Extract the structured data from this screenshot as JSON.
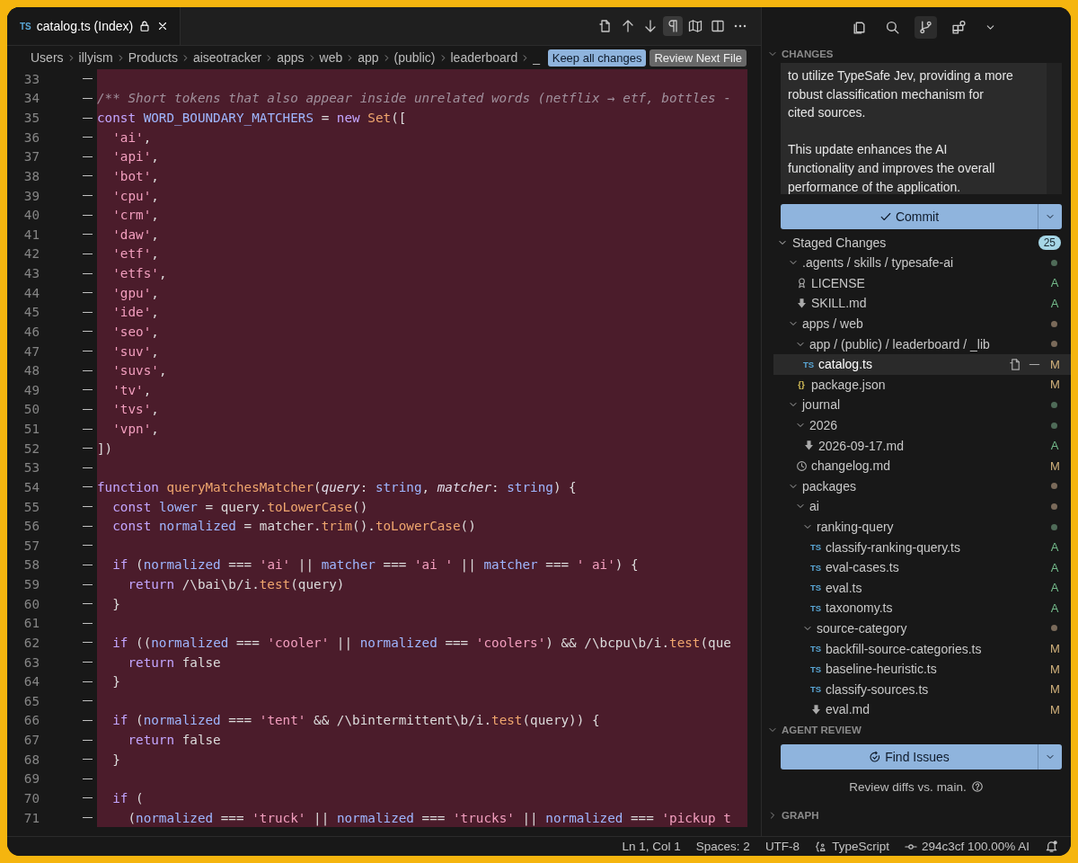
{
  "editor": {
    "tab": {
      "icon_text": "TS",
      "title": "catalog.ts (Index)",
      "locked": true
    },
    "actions": [
      {
        "selected": false
      },
      {
        "selected": false
      },
      {
        "selected": false
      },
      {
        "selected": true
      },
      {
        "selected": false
      },
      {
        "selected": false
      },
      {
        "selected": false
      }
    ],
    "breadcrumbs": [
      "Users",
      "illyism",
      "Products",
      "aiseotracker",
      "apps",
      "web",
      "app",
      "(public)",
      "leaderboard",
      "_"
    ],
    "buttons": [
      {
        "label": "Keep all changes",
        "kind": "primary"
      },
      {
        "label": "Review Next File",
        "kind": "secondary"
      }
    ],
    "lines": [
      {
        "number": "33",
        "deleted": true
      },
      {
        "number": "34",
        "deleted": true,
        "tokens": [
          {
            "kind": "comment",
            "text": "/** Short tokens that also appear inside unrelated words (netflix → etf, bottles -"
          }
        ]
      },
      {
        "number": "35",
        "deleted": true,
        "tokens": [
          {
            "kind": "kw",
            "text": "const "
          },
          {
            "kind": "var",
            "text": "WORD_BOUNDARY_MATCHERS"
          },
          {
            "kind": "plain",
            "text": " = "
          },
          {
            "kind": "kw",
            "text": "new "
          },
          {
            "kind": "fn",
            "text": "Set"
          },
          {
            "kind": "plain",
            "text": "(["
          }
        ]
      },
      {
        "number": "36",
        "deleted": true,
        "tokens": [
          {
            "kind": "str",
            "text": "  'ai'"
          },
          {
            "kind": "plain",
            "text": ","
          }
        ]
      },
      {
        "number": "37",
        "deleted": true,
        "tokens": [
          {
            "kind": "str",
            "text": "  'api'"
          },
          {
            "kind": "plain",
            "text": ","
          }
        ]
      },
      {
        "number": "38",
        "deleted": true,
        "tokens": [
          {
            "kind": "str",
            "text": "  'bot'"
          },
          {
            "kind": "plain",
            "text": ","
          }
        ]
      },
      {
        "number": "39",
        "deleted": true,
        "tokens": [
          {
            "kind": "str",
            "text": "  'cpu'"
          },
          {
            "kind": "plain",
            "text": ","
          }
        ]
      },
      {
        "number": "40",
        "deleted": true,
        "tokens": [
          {
            "kind": "str",
            "text": "  'crm'"
          },
          {
            "kind": "plain",
            "text": ","
          }
        ]
      },
      {
        "number": "41",
        "deleted": true,
        "tokens": [
          {
            "kind": "str",
            "text": "  'daw'"
          },
          {
            "kind": "plain",
            "text": ","
          }
        ]
      },
      {
        "number": "42",
        "deleted": true,
        "tokens": [
          {
            "kind": "str",
            "text": "  'etf'"
          },
          {
            "kind": "plain",
            "text": ","
          }
        ]
      },
      {
        "number": "43",
        "deleted": true,
        "tokens": [
          {
            "kind": "str",
            "text": "  'etfs'"
          },
          {
            "kind": "plain",
            "text": ","
          }
        ]
      },
      {
        "number": "44",
        "deleted": true,
        "tokens": [
          {
            "kind": "str",
            "text": "  'gpu'"
          },
          {
            "kind": "plain",
            "text": ","
          }
        ]
      },
      {
        "number": "45",
        "deleted": true,
        "tokens": [
          {
            "kind": "str",
            "text": "  'ide'"
          },
          {
            "kind": "plain",
            "text": ","
          }
        ]
      },
      {
        "number": "46",
        "deleted": true,
        "tokens": [
          {
            "kind": "str",
            "text": "  'seo'"
          },
          {
            "kind": "plain",
            "text": ","
          }
        ]
      },
      {
        "number": "47",
        "deleted": true,
        "tokens": [
          {
            "kind": "str",
            "text": "  'suv'"
          },
          {
            "kind": "plain",
            "text": ","
          }
        ]
      },
      {
        "number": "48",
        "deleted": true,
        "tokens": [
          {
            "kind": "str",
            "text": "  'suvs'"
          },
          {
            "kind": "plain",
            "text": ","
          }
        ]
      },
      {
        "number": "49",
        "deleted": true,
        "tokens": [
          {
            "kind": "str",
            "text": "  'tv'"
          },
          {
            "kind": "plain",
            "text": ","
          }
        ]
      },
      {
        "number": "50",
        "deleted": true,
        "tokens": [
          {
            "kind": "str",
            "text": "  'tvs'"
          },
          {
            "kind": "plain",
            "text": ","
          }
        ]
      },
      {
        "number": "51",
        "deleted": true,
        "tokens": [
          {
            "kind": "str",
            "text": "  'vpn'"
          },
          {
            "kind": "plain",
            "text": ","
          }
        ]
      },
      {
        "number": "52",
        "deleted": true,
        "tokens": [
          {
            "kind": "plain",
            "text": "])"
          }
        ]
      },
      {
        "number": "53",
        "deleted": true
      },
      {
        "number": "54",
        "deleted": true,
        "tokens": [
          {
            "kind": "kw",
            "text": "function "
          },
          {
            "kind": "fn",
            "text": "queryMatchesMatcher"
          },
          {
            "kind": "plain",
            "text": "("
          },
          {
            "kind": "param",
            "text": "query"
          },
          {
            "kind": "plain",
            "text": ": "
          },
          {
            "kind": "type",
            "text": "string"
          },
          {
            "kind": "plain",
            "text": ", "
          },
          {
            "kind": "param",
            "text": "matcher"
          },
          {
            "kind": "plain",
            "text": ": "
          },
          {
            "kind": "type",
            "text": "string"
          },
          {
            "kind": "plain",
            "text": ") {"
          }
        ]
      },
      {
        "number": "55",
        "deleted": true,
        "tokens": [
          {
            "kind": "kw",
            "text": "  const "
          },
          {
            "kind": "var",
            "text": "lower"
          },
          {
            "kind": "plain",
            "text": " = query."
          },
          {
            "kind": "fn",
            "text": "toLowerCase"
          },
          {
            "kind": "plain",
            "text": "()"
          }
        ]
      },
      {
        "number": "56",
        "deleted": true,
        "tokens": [
          {
            "kind": "kw",
            "text": "  const "
          },
          {
            "kind": "var",
            "text": "normalized"
          },
          {
            "kind": "plain",
            "text": " = matcher."
          },
          {
            "kind": "fn",
            "text": "trim"
          },
          {
            "kind": "plain",
            "text": "()."
          },
          {
            "kind": "fn",
            "text": "toLowerCase"
          },
          {
            "kind": "plain",
            "text": "()"
          }
        ]
      },
      {
        "number": "57",
        "deleted": true
      },
      {
        "number": "58",
        "deleted": true,
        "tokens": [
          {
            "kind": "kw",
            "text": "  if"
          },
          {
            "kind": "plain",
            "text": " ("
          },
          {
            "kind": "var",
            "text": "normalized"
          },
          {
            "kind": "plain",
            "text": " === "
          },
          {
            "kind": "str",
            "text": "'ai'"
          },
          {
            "kind": "plain",
            "text": " || "
          },
          {
            "kind": "var",
            "text": "matcher"
          },
          {
            "kind": "plain",
            "text": " === "
          },
          {
            "kind": "str",
            "text": "'ai '"
          },
          {
            "kind": "plain",
            "text": " || "
          },
          {
            "kind": "var",
            "text": "matcher"
          },
          {
            "kind": "plain",
            "text": " === "
          },
          {
            "kind": "str",
            "text": "' ai'"
          },
          {
            "kind": "plain",
            "text": ") {"
          }
        ]
      },
      {
        "number": "59",
        "deleted": true,
        "tokens": [
          {
            "kind": "kw",
            "text": "    return"
          },
          {
            "kind": "plain",
            "text": " /\\bai\\b/i."
          },
          {
            "kind": "fn",
            "text": "test"
          },
          {
            "kind": "plain",
            "text": "(query)"
          }
        ]
      },
      {
        "number": "60",
        "deleted": true,
        "tokens": [
          {
            "kind": "plain",
            "text": "  }"
          }
        ]
      },
      {
        "number": "61",
        "deleted": true
      },
      {
        "number": "62",
        "deleted": true,
        "tokens": [
          {
            "kind": "kw",
            "text": "  if"
          },
          {
            "kind": "plain",
            "text": " (("
          },
          {
            "kind": "var",
            "text": "normalized"
          },
          {
            "kind": "plain",
            "text": " === "
          },
          {
            "kind": "str",
            "text": "'cooler'"
          },
          {
            "kind": "plain",
            "text": " || "
          },
          {
            "kind": "var",
            "text": "normalized"
          },
          {
            "kind": "plain",
            "text": " === "
          },
          {
            "kind": "str",
            "text": "'coolers'"
          },
          {
            "kind": "plain",
            "text": ") && /\\bcpu\\b/i."
          },
          {
            "kind": "fn",
            "text": "test"
          },
          {
            "kind": "plain",
            "text": "(que"
          }
        ]
      },
      {
        "number": "63",
        "deleted": true,
        "tokens": [
          {
            "kind": "kw",
            "text": "    return"
          },
          {
            "kind": "plain",
            "text": " false"
          }
        ]
      },
      {
        "number": "64",
        "deleted": true,
        "tokens": [
          {
            "kind": "plain",
            "text": "  }"
          }
        ]
      },
      {
        "number": "65",
        "deleted": true
      },
      {
        "number": "66",
        "deleted": true,
        "tokens": [
          {
            "kind": "kw",
            "text": "  if"
          },
          {
            "kind": "plain",
            "text": " ("
          },
          {
            "kind": "var",
            "text": "normalized"
          },
          {
            "kind": "plain",
            "text": " === "
          },
          {
            "kind": "str",
            "text": "'tent'"
          },
          {
            "kind": "plain",
            "text": " && /\\bintermittent\\b/i."
          },
          {
            "kind": "fn",
            "text": "test"
          },
          {
            "kind": "plain",
            "text": "(query)) {"
          }
        ]
      },
      {
        "number": "67",
        "deleted": true,
        "tokens": [
          {
            "kind": "kw",
            "text": "    return"
          },
          {
            "kind": "plain",
            "text": " false"
          }
        ]
      },
      {
        "number": "68",
        "deleted": true,
        "tokens": [
          {
            "kind": "plain",
            "text": "  }"
          }
        ]
      },
      {
        "number": "69",
        "deleted": true
      },
      {
        "number": "70",
        "deleted": true,
        "tokens": [
          {
            "kind": "kw",
            "text": "  if"
          },
          {
            "kind": "plain",
            "text": " ("
          }
        ]
      },
      {
        "number": "71",
        "deleted": true,
        "tokens": [
          {
            "kind": "plain",
            "text": "    ("
          },
          {
            "kind": "var",
            "text": "normalized"
          },
          {
            "kind": "plain",
            "text": " === "
          },
          {
            "kind": "str",
            "text": "'truck'"
          },
          {
            "kind": "plain",
            "text": " || "
          },
          {
            "kind": "var",
            "text": "normalized"
          },
          {
            "kind": "plain",
            "text": " === "
          },
          {
            "kind": "str",
            "text": "'trucks'"
          },
          {
            "kind": "plain",
            "text": " || "
          },
          {
            "kind": "var",
            "text": "normalized"
          },
          {
            "kind": "plain",
            "text": " === "
          },
          {
            "kind": "str",
            "text": "'pickup t"
          }
        ]
      }
    ]
  },
  "sidebar": {
    "views": [
      {
        "selected": false
      },
      {
        "selected": false
      },
      {
        "selected": true
      },
      {
        "selected": false
      },
      {
        "selected": false
      }
    ],
    "changes": {
      "title": "CHANGES",
      "expanded": true,
      "message": "to utilize TypeSafe Jev, providing a more\nrobust classification mechanism for\ncited sources.\n\nThis update enhances the AI\nfunctionality and improves the overall\nperformance of the application.",
      "commit_label": "Commit",
      "staged": {
        "label": "Staged Changes",
        "count": "25",
        "expanded": true,
        "items": [
          {
            "kind": "folder",
            "name": ".agents / skills / typesafe-ai",
            "expanded": true,
            "selected": false,
            "color": "#4f6b58",
            "children": [
              {
                "kind": "license",
                "name": "LICENSE",
                "status": "A",
                "color": "#73b98a",
                "selected": false
              },
              {
                "kind": "markdown",
                "name": "SKILL.md",
                "status": "A",
                "color": "#73b98a",
                "selected": false
              }
            ]
          },
          {
            "kind": "folder",
            "name": "apps / web",
            "expanded": true,
            "selected": false,
            "color": "#7a6a5a",
            "children": [
              {
                "kind": "folder",
                "name": "app / (public) / leaderboard / _lib",
                "expanded": true,
                "selected": false,
                "color": "#7a6a5a",
                "children": [
                  {
                    "kind": "typescript",
                    "icon_text": "TS",
                    "name": "catalog.ts",
                    "status": "M",
                    "color": "#d2b27c",
                    "selected": true
                  }
                ]
              },
              {
                "kind": "json",
                "icon_text": "{}",
                "name": "package.json",
                "status": "M",
                "color": "#d2b27c",
                "selected": false
              }
            ]
          },
          {
            "kind": "folder",
            "name": "journal",
            "expanded": true,
            "selected": false,
            "color": "#4f6b58",
            "children": [
              {
                "kind": "folder",
                "name": "2026",
                "expanded": true,
                "selected": false,
                "color": "#4f6b58",
                "children": [
                  {
                    "kind": "markdown",
                    "name": "2026-09-17.md",
                    "status": "A",
                    "color": "#73b98a",
                    "selected": false
                  }
                ]
              },
              {
                "kind": "history",
                "name": "changelog.md",
                "status": "M",
                "color": "#d2b27c",
                "selected": false
              }
            ]
          },
          {
            "kind": "folder",
            "name": "packages",
            "expanded": true,
            "selected": false,
            "color": "#7a6a5a",
            "children": [
              {
                "kind": "folder",
                "name": "ai",
                "expanded": true,
                "selected": false,
                "color": "#7a6a5a",
                "children": [
                  {
                    "kind": "folder",
                    "name": "ranking-query",
                    "expanded": true,
                    "selected": false,
                    "color": "#4f6b58",
                    "children": [
                      {
                        "kind": "typescript",
                        "icon_text": "TS",
                        "name": "classify-ranking-query.ts",
                        "status": "A",
                        "color": "#73b98a",
                        "selected": false
                      },
                      {
                        "kind": "typescript",
                        "icon_text": "TS",
                        "name": "eval-cases.ts",
                        "status": "A",
                        "color": "#73b98a",
                        "selected": false
                      },
                      {
                        "kind": "typescript",
                        "icon_text": "TS",
                        "name": "eval.ts",
                        "status": "A",
                        "color": "#73b98a",
                        "selected": false
                      },
                      {
                        "kind": "typescript",
                        "icon_text": "TS",
                        "name": "taxonomy.ts",
                        "status": "A",
                        "color": "#73b98a",
                        "selected": false
                      }
                    ]
                  },
                  {
                    "kind": "folder",
                    "name": "source-category",
                    "expanded": true,
                    "selected": false,
                    "color": "#7a6a5a",
                    "children": [
                      {
                        "kind": "typescript",
                        "icon_text": "TS",
                        "name": "backfill-source-categories.ts",
                        "status": "M",
                        "color": "#d2b27c",
                        "selected": false
                      },
                      {
                        "kind": "typescript",
                        "icon_text": "TS",
                        "name": "baseline-heuristic.ts",
                        "status": "M",
                        "color": "#d2b27c",
                        "selected": false
                      },
                      {
                        "kind": "typescript",
                        "icon_text": "TS",
                        "name": "classify-sources.ts",
                        "status": "M",
                        "color": "#d2b27c",
                        "selected": false
                      },
                      {
                        "kind": "markdown",
                        "name": "eval.md",
                        "status": "M",
                        "color": "#d2b27c",
                        "selected": false
                      }
                    ]
                  }
                ]
              }
            ]
          }
        ]
      }
    },
    "agent_review": {
      "title": "AGENT REVIEW",
      "expanded": true,
      "button": "Find Issues",
      "hint": "Review diffs vs. main."
    },
    "graph": {
      "title": "GRAPH",
      "expanded": false
    }
  },
  "status_bar": {
    "position": "Ln 1, Col 1",
    "indent": "Spaces: 2",
    "encoding": "UTF-8",
    "language": "TypeScript",
    "commit": "294c3cf 100.00% AI"
  }
}
